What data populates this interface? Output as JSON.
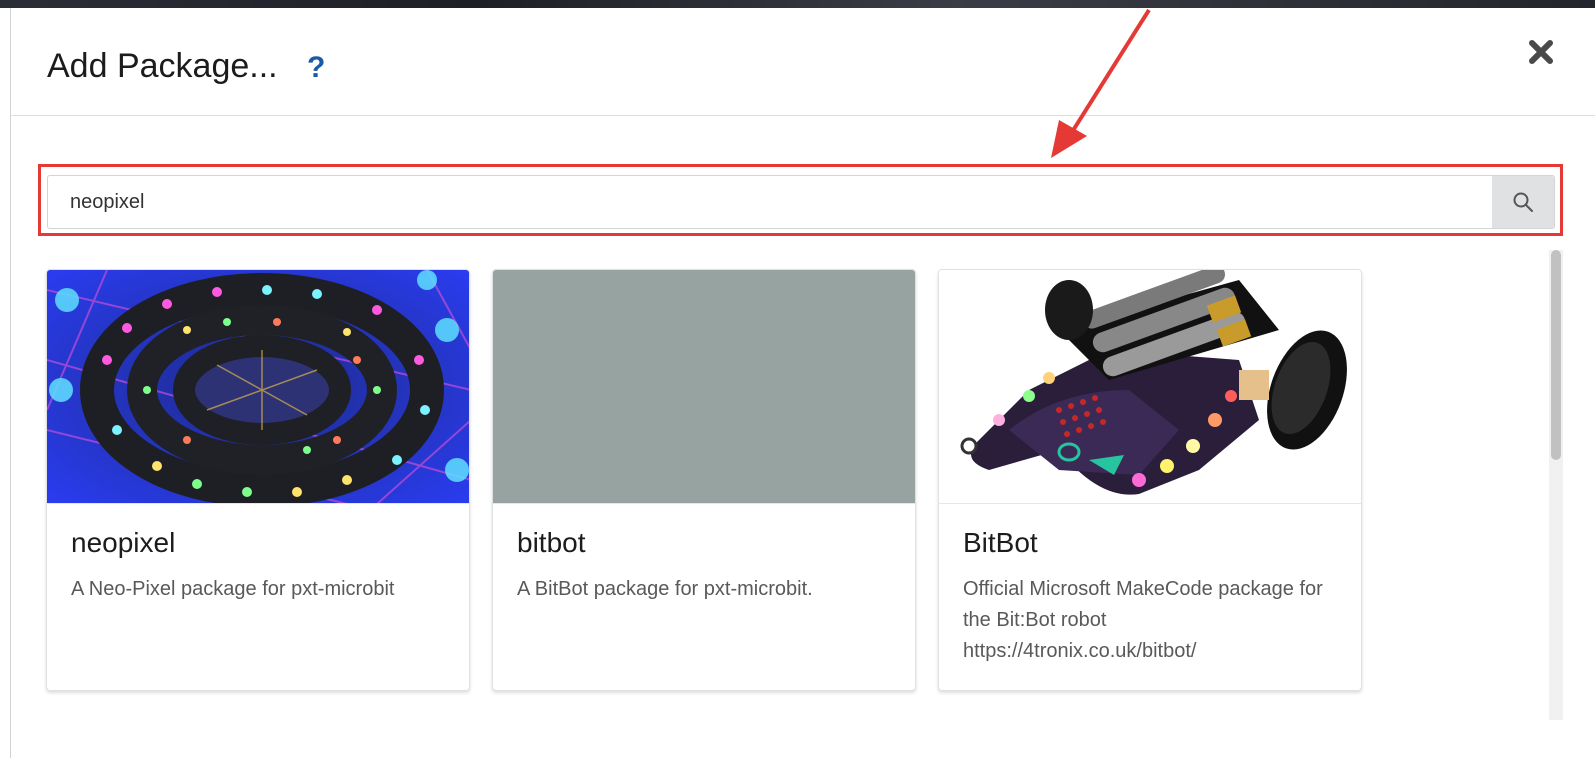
{
  "dialog": {
    "title": "Add Package...",
    "help_symbol": "?",
    "close_icon": "close-icon"
  },
  "search": {
    "value": "neopixel",
    "placeholder": "",
    "button_icon": "search-icon"
  },
  "colors": {
    "highlight": "#e53935",
    "help": "#1b5aa8",
    "placeholder_image": "#96a3a1"
  },
  "packages": [
    {
      "name": "neopixel",
      "description": "A Neo-Pixel package for pxt-microbit",
      "image": "neopixel-led-strip-image"
    },
    {
      "name": "bitbot",
      "description": "A BitBot package for pxt-microbit.",
      "image": "placeholder-image"
    },
    {
      "name": "BitBot",
      "description": "Official Microsoft MakeCode package for the Bit:Bot robot https://4tronix.co.uk/bitbot/",
      "image": "bitbot-robot-image"
    }
  ]
}
